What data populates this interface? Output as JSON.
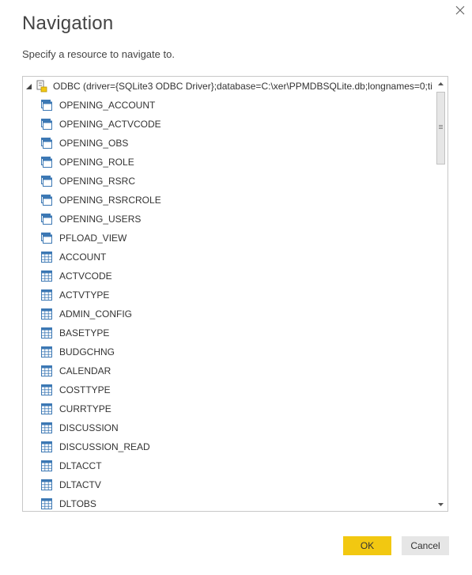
{
  "dialog": {
    "title": "Navigation",
    "subtitle": "Specify a resource to navigate to.",
    "close_icon": "close-icon"
  },
  "tree": {
    "root": {
      "label": "ODBC (driver={SQLite3 ODBC Driver};database=C:\\xer\\PPMDBSQLite.db;longnames=0;ti...",
      "icon": "database-icon",
      "expanded": true
    },
    "items": [
      {
        "label": "OPENING_ACCOUNT",
        "icon": "view-icon"
      },
      {
        "label": "OPENING_ACTVCODE",
        "icon": "view-icon"
      },
      {
        "label": "OPENING_OBS",
        "icon": "view-icon"
      },
      {
        "label": "OPENING_ROLE",
        "icon": "view-icon"
      },
      {
        "label": "OPENING_RSRC",
        "icon": "view-icon"
      },
      {
        "label": "OPENING_RSRCROLE",
        "icon": "view-icon"
      },
      {
        "label": "OPENING_USERS",
        "icon": "view-icon"
      },
      {
        "label": "PFLOAD_VIEW",
        "icon": "view-icon"
      },
      {
        "label": "ACCOUNT",
        "icon": "table-icon"
      },
      {
        "label": "ACTVCODE",
        "icon": "table-icon"
      },
      {
        "label": "ACTVTYPE",
        "icon": "table-icon"
      },
      {
        "label": "ADMIN_CONFIG",
        "icon": "table-icon"
      },
      {
        "label": "BASETYPE",
        "icon": "table-icon"
      },
      {
        "label": "BUDGCHNG",
        "icon": "table-icon"
      },
      {
        "label": "CALENDAR",
        "icon": "table-icon"
      },
      {
        "label": "COSTTYPE",
        "icon": "table-icon"
      },
      {
        "label": "CURRTYPE",
        "icon": "table-icon"
      },
      {
        "label": "DISCUSSION",
        "icon": "table-icon"
      },
      {
        "label": "DISCUSSION_READ",
        "icon": "table-icon"
      },
      {
        "label": "DLTACCT",
        "icon": "table-icon"
      },
      {
        "label": "DLTACTV",
        "icon": "table-icon"
      },
      {
        "label": "DLTOBS",
        "icon": "table-icon"
      }
    ]
  },
  "buttons": {
    "ok_label": "OK",
    "cancel_label": "Cancel"
  },
  "colors": {
    "ok_bg": "#f2c811",
    "cancel_bg": "#e6e6e6",
    "icon_blue": "#3c78b4"
  }
}
